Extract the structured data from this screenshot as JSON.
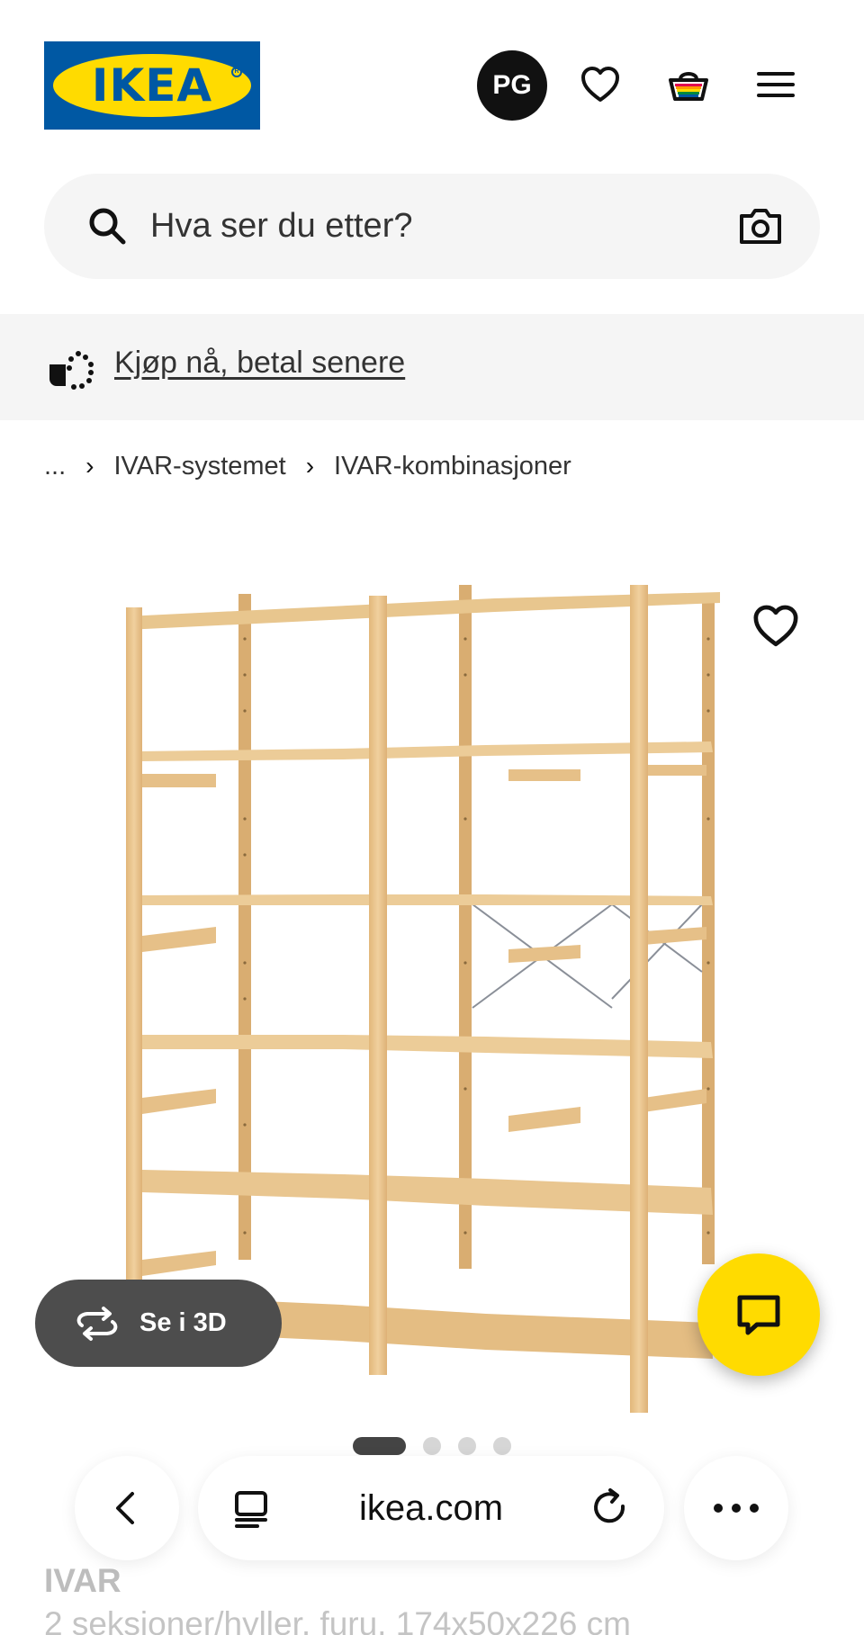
{
  "header": {
    "logo_text": "IKEA",
    "avatar_initials": "PG",
    "icons": [
      "heart-icon",
      "basket-icon",
      "hamburger-menu-icon"
    ]
  },
  "search": {
    "placeholder": "Hva ser du etter?",
    "icons": [
      "search-icon",
      "camera-icon"
    ]
  },
  "promo": {
    "label": "Kjøp nå, betal senere",
    "icon": "pay-later-icon"
  },
  "breadcrumb": {
    "ellipsis": "...",
    "items": [
      "IVAR-systemet",
      "IVAR-kombinasjoner"
    ]
  },
  "product": {
    "view_3d_label": "Se i 3D",
    "image_count": 4,
    "active_image": 1,
    "name": "IVAR",
    "description": "2 seksjoner/hyller, furu, 174x50x226 cm"
  },
  "browser": {
    "url": "ikea.com",
    "icons": [
      "back-icon",
      "tabs-icon",
      "reload-icon",
      "more-icon"
    ]
  },
  "colors": {
    "ikea_blue": "#0058a3",
    "ikea_yellow": "#ffdb00",
    "pine": "#e9c690"
  }
}
